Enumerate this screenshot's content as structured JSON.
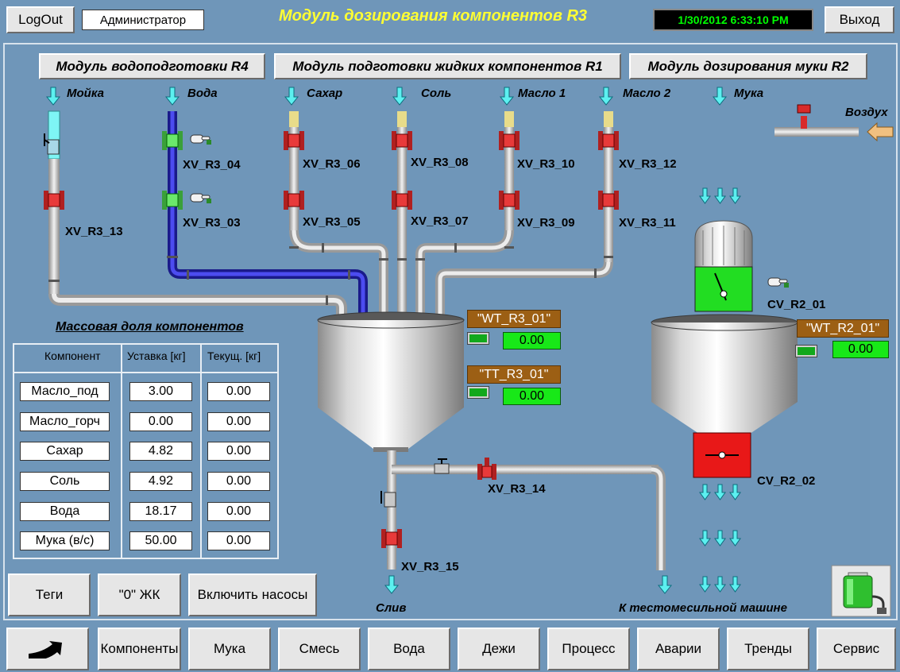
{
  "header": {
    "logout_label": "LogOut",
    "user": "Администратор",
    "title": "Модуль дозирования компонентов R3",
    "datetime": "1/30/2012 6:33:10 PM",
    "exit_label": "Выход"
  },
  "modules": {
    "r4": "Модуль водоподготовки R4",
    "r1": "Модуль подготовки жидких компонентов R1",
    "r2": "Модуль дозирования муки R2"
  },
  "inputs": {
    "moyka": "Мойка",
    "voda": "Вода",
    "sakhar": "Сахар",
    "sol": "Соль",
    "maslo1": "Масло 1",
    "maslo2": "Масло 2",
    "muka": "Мука",
    "vozdukh": "Воздух"
  },
  "valves": {
    "xv04": "XV_R3_04",
    "xv03": "XV_R3_03",
    "xv06": "XV_R3_06",
    "xv05": "XV_R3_05",
    "xv08": "XV_R3_08",
    "xv07": "XV_R3_07",
    "xv10": "XV_R3_10",
    "xv09": "XV_R3_09",
    "xv12": "XV_R3_12",
    "xv11": "XV_R3_11",
    "xv13": "XV_R3_13",
    "xv14": "XV_R3_14",
    "xv15": "XV_R3_15",
    "cv01": "CV_R2_01",
    "cv02": "CV_R2_02"
  },
  "instruments": {
    "wt_r3_tag": "\"WT_R3_01\"",
    "wt_r3_value": "0.00",
    "tt_r3_tag": "\"TT_R3_01\"",
    "tt_r3_value": "0.00",
    "wt_r2_tag": "\"WT_R2_01\"",
    "wt_r2_value": "0.00"
  },
  "outputs": {
    "drain": "Слив",
    "to_mixer": "К тестомесильной машине"
  },
  "table": {
    "title": "Массовая доля компонентов",
    "headers": [
      "Компонент",
      "Уставка [кг]",
      "Текущ. [кг]"
    ],
    "rows": [
      {
        "name": "Масло_под",
        "setpoint": "3.00",
        "current": "0.00"
      },
      {
        "name": "Масло_горч",
        "setpoint": "0.00",
        "current": "0.00"
      },
      {
        "name": "Сахар",
        "setpoint": "4.82",
        "current": "0.00"
      },
      {
        "name": "Соль",
        "setpoint": "4.92",
        "current": "0.00"
      },
      {
        "name": "Вода",
        "setpoint": "18.17",
        "current": "0.00"
      },
      {
        "name": "Мука (в/с)",
        "setpoint": "50.00",
        "current": "0.00"
      }
    ]
  },
  "actions": {
    "tags": "Теги",
    "zero_zhk": "\"0\" ЖК",
    "pumps_on": "Включить насосы"
  },
  "nav": {
    "back_icon": "return-arrow-icon",
    "items": [
      "Компоненты",
      "Мука",
      "Смесь",
      "Вода",
      "Дежи",
      "Процесс",
      "Аварии",
      "Тренды",
      "Сервис"
    ]
  },
  "colors": {
    "background": "#6f96b9",
    "title": "#ffff33",
    "clock_text": "#00ff00",
    "value_green": "#18e818",
    "tag_brown": "#9c5f14",
    "valve_red": "#e83a3a",
    "valve_green": "#6be86b",
    "water_pipe": "#2b2bd0",
    "wash_pipe": "#7ef5f5"
  }
}
